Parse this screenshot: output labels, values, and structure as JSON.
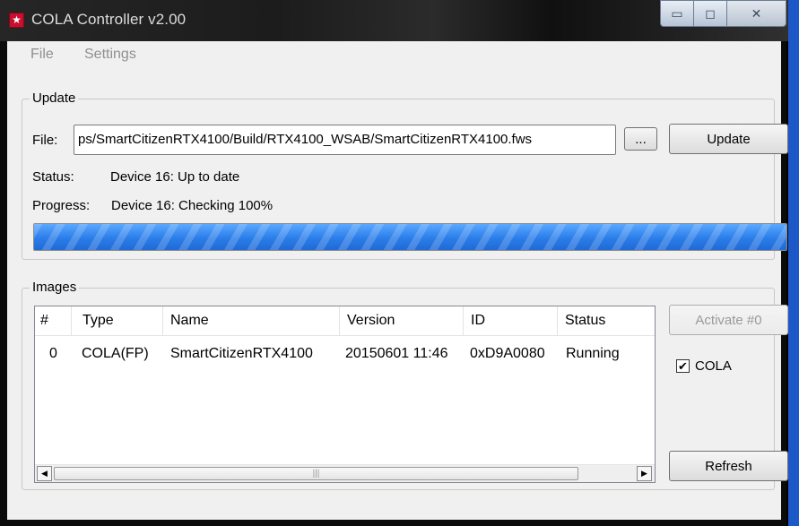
{
  "window": {
    "title": "COLA Controller v2.00",
    "app_icon_glyph": "★",
    "icons": {
      "app": "app-star-icon",
      "minimize": "minimize-icon",
      "maximize": "maximize-icon",
      "close": "close-icon"
    },
    "caption_glyphs": {
      "minimize": "▭",
      "maximize": "◻",
      "close": "✕"
    }
  },
  "menu": {
    "file": "File",
    "settings": "Settings"
  },
  "update": {
    "group_label": "Update",
    "file_label": "File:",
    "file_path": "ps/SmartCitizenRTX4100/Build/RTX4100_WSAB/SmartCitizenRTX4100.fws",
    "browse_label": "...",
    "update_label": "Update",
    "status_label": "Status:",
    "status_value": "Device 16: Up to date",
    "progress_label": "Progress:",
    "progress_value": "Device 16: Checking 100%",
    "progress_percent": 100,
    "progress_color": "#2b7de9"
  },
  "images": {
    "group_label": "Images",
    "columns": [
      "#",
      "Type",
      "Name",
      "Version",
      "ID",
      "Status"
    ],
    "rows": [
      {
        "num": "0",
        "type": "COLA(FP)",
        "name": "SmartCitizenRTX4100",
        "version": "20150601 11:46",
        "id": "0xD9A0080",
        "status": "Running"
      }
    ],
    "activate_label": "Activate #0",
    "cola_checkbox_label": "COLA",
    "cola_checked": true,
    "check_glyph": "✔",
    "refresh_label": "Refresh",
    "scroll_left_glyph": "◀",
    "scroll_right_glyph": "▶",
    "scroll_grip_glyph": "|||"
  }
}
